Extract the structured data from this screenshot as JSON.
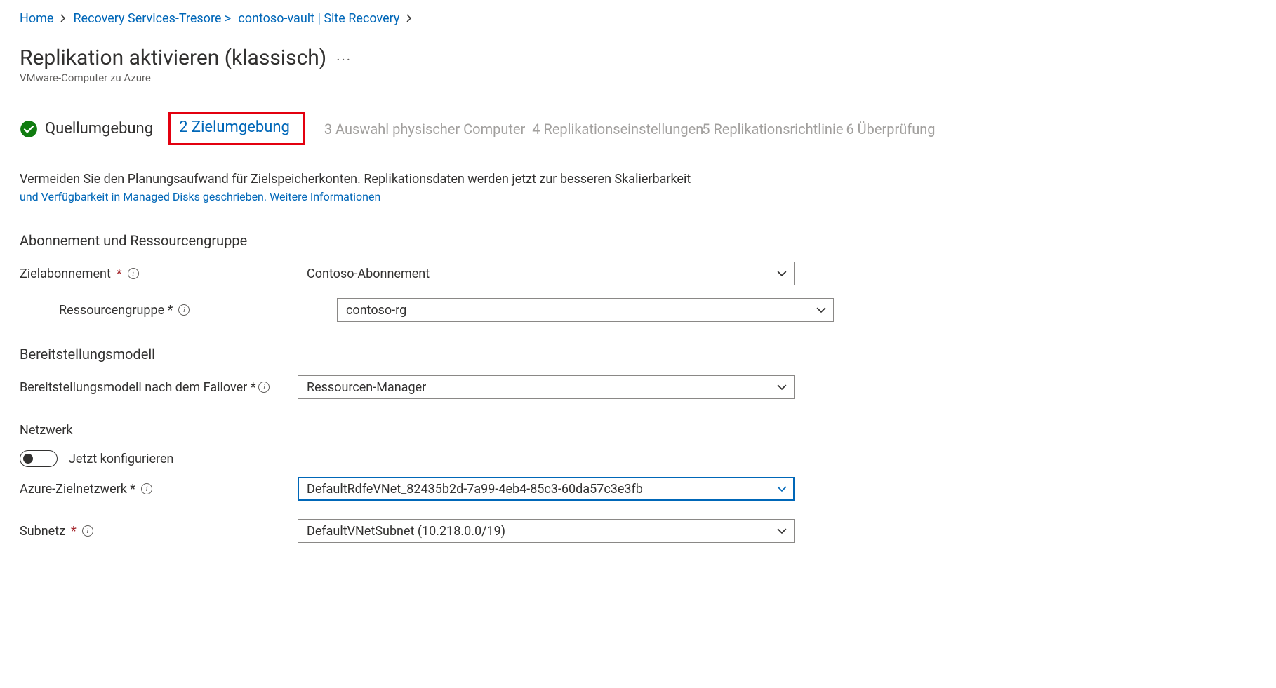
{
  "breadcrumb": {
    "home": "Home",
    "vaults": "Recovery Services-Tresore",
    "vault_instance": "contoso-vault | Site Recovery"
  },
  "page": {
    "title": "Replikation aktivieren (klassisch)",
    "subtitle": "VMware-Computer zu Azure"
  },
  "wizard": {
    "step1": "Quellumgebung",
    "step2": "2 Zielumgebung",
    "step3": "3 Auswahl physischer Computer",
    "step4": "4 Replikationseinstellungen",
    "step5": "5 Replikationsrichtlinie",
    "step6": "6 Überprüfung"
  },
  "info": {
    "line1": "Vermeiden Sie den Planungsaufwand für Zielspeicherkonten. Replikationsdaten werden jetzt zur besseren Skalierbarkeit",
    "link": "und Verfügbarkeit in Managed Disks geschrieben. Weitere Informationen"
  },
  "sections": {
    "sub_rg_heading": "Abonnement und Ressourcengruppe",
    "target_subscription_label": "Zielabonnement",
    "target_subscription_value": "Contoso-Abonnement",
    "resource_group_label": "Ressourcengruppe *",
    "resource_group_value": "contoso-rg",
    "deployment_heading": "Bereitstellungsmodell",
    "deployment_label": "Bereitstellungsmodell nach dem Failover *",
    "deployment_value": "Ressourcen-Manager",
    "network_heading": "Netzwerk",
    "toggle_label": "Jetzt konfigurieren",
    "target_network_label": "Azure-Zielnetzwerk *",
    "target_network_value": "DefaultRdfeVNet_82435b2d-7a99-4eb4-85c3-60da57c3e3fb",
    "subnet_label": "Subnetz",
    "subnet_value": "DefaultVNetSubnet (10.218.0.0/19)"
  }
}
